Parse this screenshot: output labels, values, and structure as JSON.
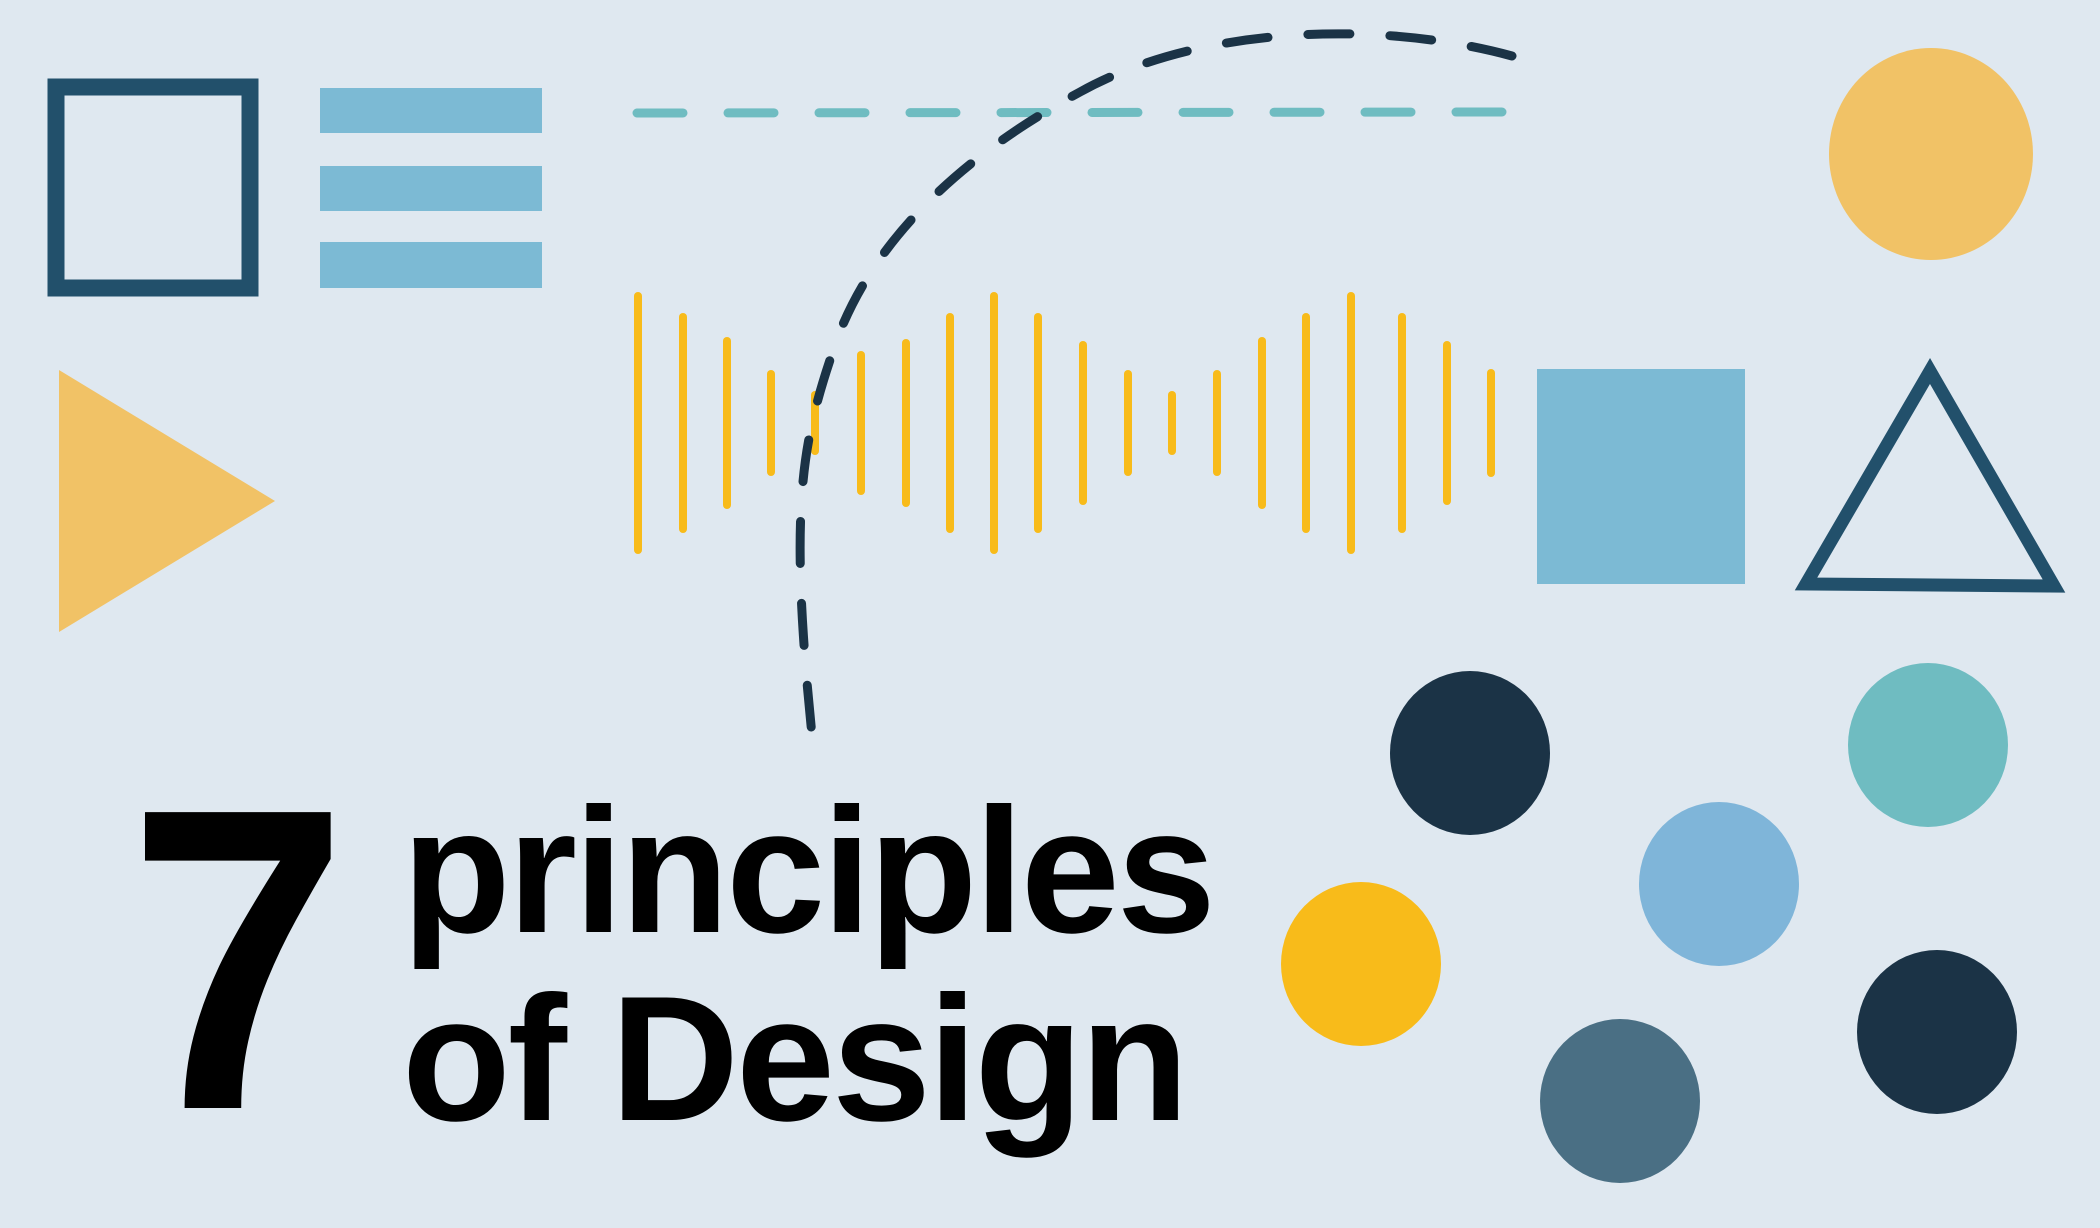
{
  "title": {
    "number": "7",
    "line1": "principles",
    "line2": "of Design"
  },
  "colors": {
    "background": "#dfe8f0",
    "navy": "#22506b",
    "dark_navy": "#1b3346",
    "light_blue": "#7cbad4",
    "sand_yellow": "#f1c266",
    "gold": "#f8bb1a",
    "teal": "#6fbcc1",
    "sky_blue": "#7fb5d9",
    "slate": "#4a6f84",
    "text": "#000000"
  },
  "icons": [
    "square-outline-icon",
    "hamburger-bars-icon",
    "play-triangle-icon",
    "equalizer-bars-icon",
    "dashed-line-icon",
    "dashed-curve-icon",
    "circle-icon",
    "square-solid-icon",
    "triangle-outline-icon",
    "dots-cluster-icon"
  ]
}
